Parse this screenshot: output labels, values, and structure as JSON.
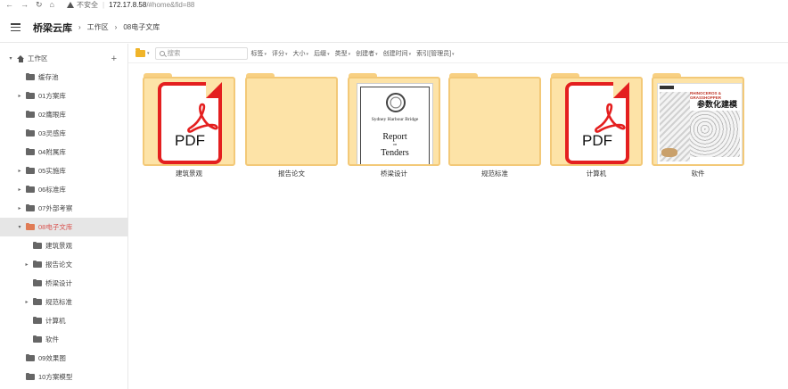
{
  "browser": {
    "nav_icons": [
      "back-arrow-icon",
      "forward-arrow-icon",
      "reload-icon",
      "home-icon"
    ],
    "security_label": "不安全",
    "url_host": "172.17.8.58",
    "url_path": "/#home&fid=88"
  },
  "header": {
    "brand": "桥梁云库",
    "breadcrumb": [
      "工作区",
      "08电子文库"
    ]
  },
  "sidebar": {
    "root_label": "工作区",
    "items": [
      {
        "label": "缓存池",
        "caret": false,
        "level": 1,
        "active": false
      },
      {
        "label": "01方案库",
        "caret": true,
        "level": 1,
        "active": false
      },
      {
        "label": "02鹰眼库",
        "caret": false,
        "level": 1,
        "active": false
      },
      {
        "label": "03灵感库",
        "caret": false,
        "level": 1,
        "active": false
      },
      {
        "label": "04附属库",
        "caret": false,
        "level": 1,
        "active": false
      },
      {
        "label": "05实施库",
        "caret": true,
        "level": 1,
        "active": false
      },
      {
        "label": "06标准库",
        "caret": true,
        "level": 1,
        "active": false
      },
      {
        "label": "07外部考察",
        "caret": true,
        "level": 1,
        "active": false
      },
      {
        "label": "08电子文库",
        "caret": true,
        "level": 1,
        "active": true,
        "expanded": true
      },
      {
        "label": "建筑景观",
        "caret": false,
        "level": 2,
        "active": false
      },
      {
        "label": "报告论文",
        "caret": true,
        "level": 2,
        "active": false
      },
      {
        "label": "桥梁设计",
        "caret": false,
        "level": 2,
        "active": false
      },
      {
        "label": "规范标准",
        "caret": true,
        "level": 2,
        "active": false
      },
      {
        "label": "计算机",
        "caret": false,
        "level": 2,
        "active": false
      },
      {
        "label": "软件",
        "caret": false,
        "level": 2,
        "active": false
      },
      {
        "label": "09效果图",
        "caret": false,
        "level": 1,
        "active": false
      },
      {
        "label": "10方案模型",
        "caret": false,
        "level": 1,
        "active": false
      }
    ]
  },
  "toolbar": {
    "search_placeholder": "搜索",
    "filters": [
      "标签",
      "评分",
      "大小",
      "后缀",
      "类型",
      "创建者",
      "创建时间",
      "索引[管理员]"
    ]
  },
  "folders": [
    {
      "label": "建筑景观",
      "thumb": "pdf",
      "thumb_text": "PDF"
    },
    {
      "label": "报告论文",
      "thumb": "empty"
    },
    {
      "label": "桥梁设计",
      "thumb": "report",
      "report_lines": [
        "Sydney Harbour Bridge",
        "Report",
        "on",
        "Tenders"
      ]
    },
    {
      "label": "规范标准",
      "thumb": "empty"
    },
    {
      "label": "计算机",
      "thumb": "pdf",
      "thumb_text": "PDF"
    },
    {
      "label": "软件",
      "thumb": "book",
      "book_lines": [
        "RHINOCEROS & GRASSHOPPER",
        "参数化建模"
      ]
    }
  ],
  "colors": {
    "folder_body": "#fde3a7",
    "folder_border": "#f3c978",
    "active_text": "#d9534f",
    "pdf_red": "#e41f1f"
  }
}
